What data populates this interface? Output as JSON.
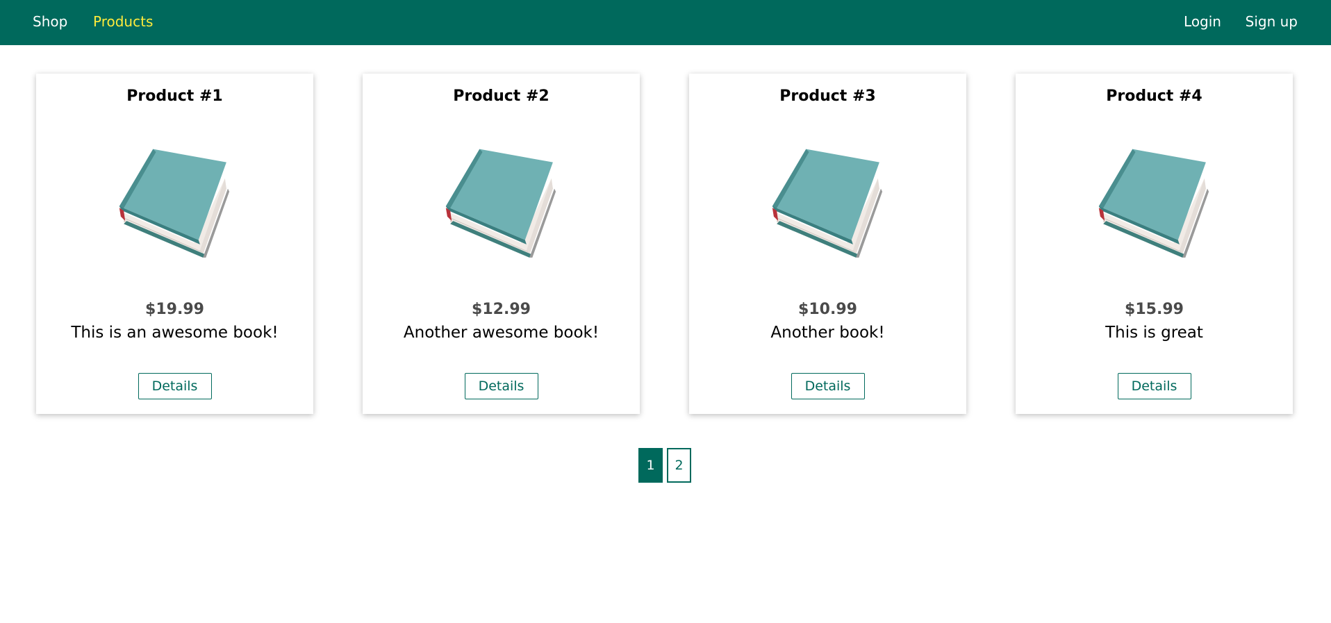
{
  "nav": {
    "shop": "Shop",
    "products": "Products",
    "login": "Login",
    "signup": "Sign up"
  },
  "colors": {
    "primary": "#00695c",
    "active_nav": "#ffeb3b"
  },
  "products": [
    {
      "title": "Product #1",
      "price": "$19.99",
      "description": "This is an awesome book!",
      "button": "Details",
      "image": "book-image"
    },
    {
      "title": "Product #2",
      "price": "$12.99",
      "description": "Another awesome book!",
      "button": "Details",
      "image": "book-image"
    },
    {
      "title": "Product #3",
      "price": "$10.99",
      "description": "Another book!",
      "button": "Details",
      "image": "book-image"
    },
    {
      "title": "Product #4",
      "price": "$15.99",
      "description": "This is great",
      "button": "Details",
      "image": "book-image"
    }
  ],
  "pagination": {
    "pages": [
      "1",
      "2"
    ],
    "current": "1"
  }
}
